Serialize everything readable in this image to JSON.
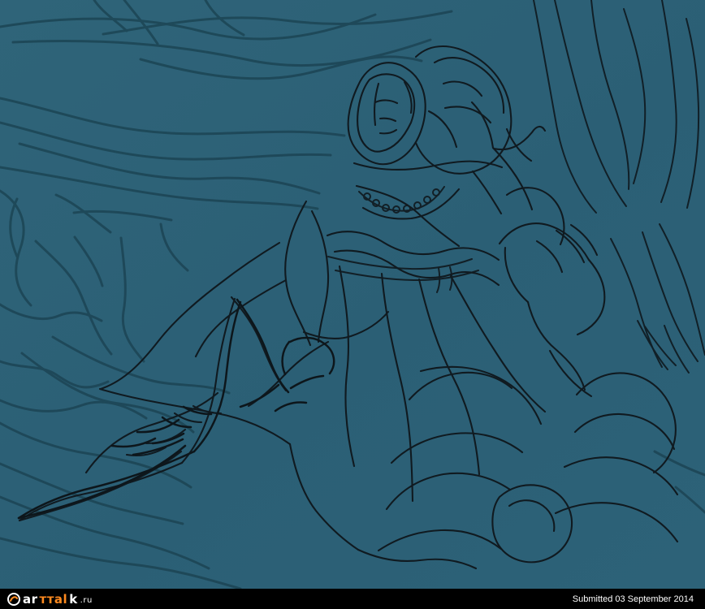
{
  "artwork": {
    "background_color": "#2e6278",
    "line_color": "#111a1f",
    "scribble_color": "#163746",
    "subject": "sketch-of-armored-hooded-knight-with-sword"
  },
  "footer": {
    "brand_part_a": "ar",
    "brand_part_b": "ттаl",
    "brand_part_c": "k",
    "brand_tld": ".ru",
    "submission_text": "Submitted 03 September 2014",
    "background_color": "#000000",
    "brand_accent_color": "#ff8a1f"
  }
}
